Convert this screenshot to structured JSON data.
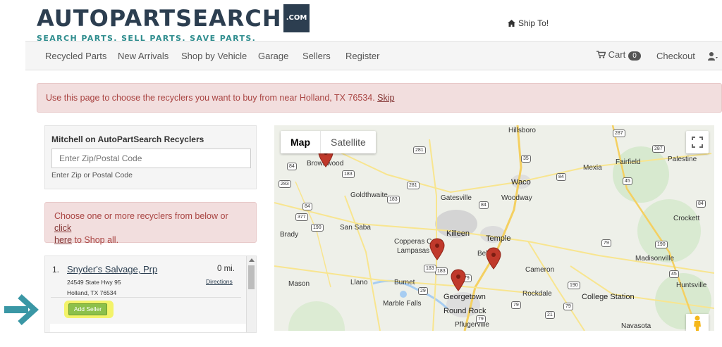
{
  "header": {
    "logo_main": "AUTOPARTSEARCH",
    "logo_dotcom": ".COM",
    "logo_tagline": "SEARCH PARTS. SELL PARTS. SAVE PARTS.",
    "ship_to": "Ship To!"
  },
  "nav": {
    "items": [
      {
        "label": "Recycled Parts"
      },
      {
        "label": "New Arrivals"
      },
      {
        "label": "Shop by Vehicle"
      },
      {
        "label": "Garage"
      },
      {
        "label": "Sellers"
      },
      {
        "label": "Register"
      }
    ],
    "cart_label": "Cart",
    "cart_count": "0",
    "checkout_label": "Checkout"
  },
  "alert": {
    "text": "Use this page to choose the recyclers you want to buy from near Holland, TX  76534. ",
    "skip": "Skip"
  },
  "search": {
    "title": "Mitchell on AutoPartSearch Recyclers",
    "placeholder": "Enter Zip/Postal Code",
    "help": "Enter Zip or Postal Code"
  },
  "choose": {
    "text_before": "Choose one or more recyclers from below or ",
    "link_click": "click",
    "link_here": "here",
    "text_after": " to Shop all."
  },
  "recyclers": [
    {
      "num": "1.",
      "name": "Snyder's Salvage, Prp",
      "distance": "0 mi.",
      "address1": "24549 State Hwy 95",
      "address2": "Holland, TX 76534",
      "directions": "Directions",
      "add_label": "Add Seller"
    }
  ],
  "map": {
    "tab_map": "Map",
    "tab_satellite": "Satellite",
    "cities": [
      {
        "name": "Hillsboro",
        "big": false
      },
      {
        "name": "Brownwood",
        "big": false
      },
      {
        "name": "Waco",
        "big": true
      },
      {
        "name": "Mexia",
        "big": false
      },
      {
        "name": "Fairfield",
        "big": false
      },
      {
        "name": "Palestine",
        "big": false
      },
      {
        "name": "Goldthwaite",
        "big": false
      },
      {
        "name": "Gatesville",
        "big": false
      },
      {
        "name": "Woodway",
        "big": false
      },
      {
        "name": "Killeen",
        "big": true
      },
      {
        "name": "Temple",
        "big": true
      },
      {
        "name": "Brady",
        "big": false
      },
      {
        "name": "San Saba",
        "big": false
      },
      {
        "name": "Copperas Cove",
        "big": false
      },
      {
        "name": "Lampasas",
        "big": false
      },
      {
        "name": "Belton",
        "big": false
      },
      {
        "name": "Crockett",
        "big": false
      },
      {
        "name": "Madisonville",
        "big": false
      },
      {
        "name": "Cameron",
        "big": false
      },
      {
        "name": "Mason",
        "big": false
      },
      {
        "name": "Llano",
        "big": false
      },
      {
        "name": "Burnet",
        "big": false
      },
      {
        "name": "Georgetown",
        "big": true
      },
      {
        "name": "Rockdale",
        "big": false
      },
      {
        "name": "Huntsville",
        "big": false
      },
      {
        "name": "Marble Falls",
        "big": false
      },
      {
        "name": "Round Rock",
        "big": true
      },
      {
        "name": "College Station",
        "big": true
      },
      {
        "name": "Pflugerville",
        "big": false
      },
      {
        "name": "Navasota",
        "big": false
      }
    ],
    "shields": [
      "281",
      "287",
      "35",
      "287",
      "84",
      "84",
      "183",
      "283",
      "281",
      "183",
      "84",
      "84",
      "84",
      "45",
      "377",
      "190",
      "79",
      "183",
      "45",
      "190",
      "79",
      "29",
      "183",
      "79",
      "79",
      "21",
      "190",
      "79"
    ]
  }
}
